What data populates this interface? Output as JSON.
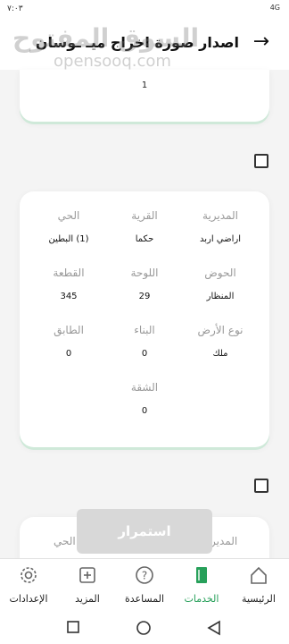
{
  "status": {
    "time": "۷:۰۳",
    "signal": "4G"
  },
  "header": {
    "title": "اصدار صورة اخراج ميـ ـوسان"
  },
  "watermark": {
    "main": "السوق المفتوح",
    "sub": "opensooq.com"
  },
  "card_top": {
    "value": "1"
  },
  "parcel": {
    "directorate_label": "المديرية",
    "directorate_value": "اراضي اربد",
    "village_label": "القرية",
    "village_value": "حكما",
    "neighborhood_label": "الحي",
    "neighborhood_value": "(1) البطين",
    "basin_label": "الحوض",
    "basin_value": "المنظار",
    "board_label": "اللوحة",
    "board_value": "29",
    "plot_label": "القطعة",
    "plot_value": "345",
    "land_type_label": "نوع الأرض",
    "land_type_value": "ملك",
    "building_label": "البناء",
    "building_value": "0",
    "floor_label": "الطابق",
    "floor_value": "0",
    "apartment_label": "الشقة",
    "apartment_value": "0"
  },
  "card_bottom": {
    "directorate_label": "المدير",
    "neighborhood_label": "الحي"
  },
  "continue_label": "استمرار",
  "nav": {
    "home": "الرئيسية",
    "services": "الخدمات",
    "help": "المساعدة",
    "more": "المزيد",
    "settings": "الإعدادات",
    "active_color": "#27a05a"
  }
}
